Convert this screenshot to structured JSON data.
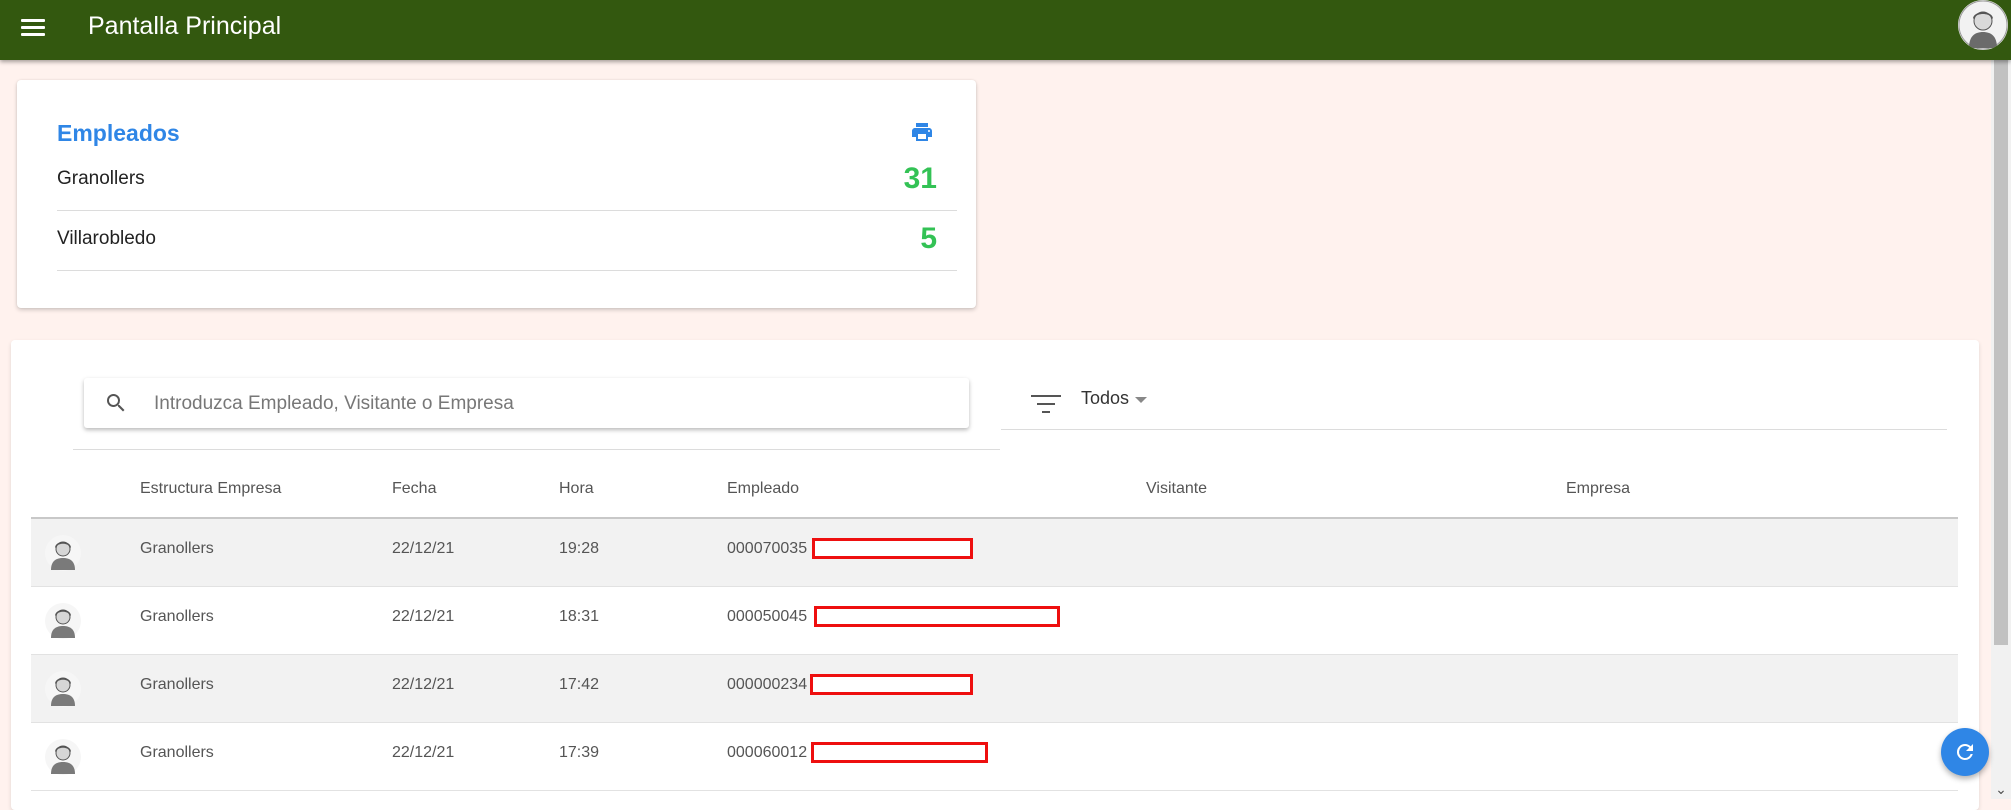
{
  "app": {
    "title": "Pantalla Principal",
    "icons": {
      "menu": "menu-icon",
      "user": "user-avatar-icon"
    },
    "colors": {
      "topbar": "#33580f",
      "accent": "#2f86e6",
      "count": "#33c255",
      "redaction": "#ee0f0f"
    }
  },
  "employees_card": {
    "title": "Empleados",
    "print_icon": "print-icon",
    "rows": [
      {
        "name": "Granollers",
        "count": "31"
      },
      {
        "name": "Villarobledo",
        "count": "5"
      }
    ]
  },
  "search": {
    "placeholder": "Introduzca Empleado, Visitante o Empresa",
    "value": ""
  },
  "filter": {
    "selected": "Todos"
  },
  "table": {
    "headers": {
      "structure": "Estructura Empresa",
      "date": "Fecha",
      "time": "Hora",
      "employee": "Empleado",
      "visitor": "Visitante",
      "company": "Empresa"
    },
    "rows": [
      {
        "structure": "Granollers",
        "date": "22/12/21",
        "time": "19:28",
        "employee_id": "000070035",
        "visitor": "",
        "company": ""
      },
      {
        "structure": "Granollers",
        "date": "22/12/21",
        "time": "18:31",
        "employee_id": "000050045",
        "visitor": "",
        "company": ""
      },
      {
        "structure": "Granollers",
        "date": "22/12/21",
        "time": "17:42",
        "employee_id": "000000234",
        "visitor": "",
        "company": ""
      },
      {
        "structure": "Granollers",
        "date": "22/12/21",
        "time": "17:39",
        "employee_id": "000060012",
        "visitor": "",
        "company": ""
      }
    ]
  },
  "refresh_button": {
    "icon": "refresh-icon"
  }
}
